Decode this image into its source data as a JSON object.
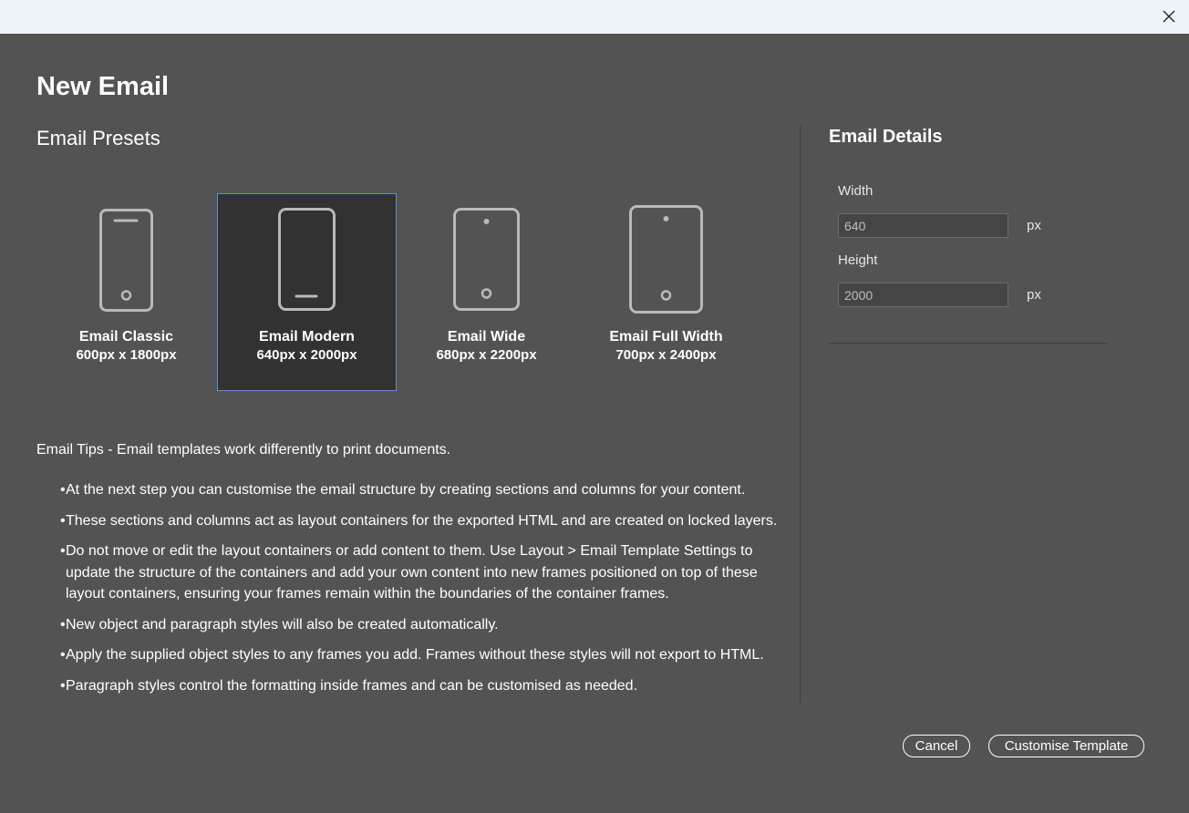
{
  "window": {
    "close_icon": "close-icon"
  },
  "dialog": {
    "title": "New Email"
  },
  "presets": {
    "heading": "Email Presets",
    "items": [
      {
        "name": "Email Classic",
        "size": "600px x 1800px",
        "selected": false,
        "icon": "phone-icon"
      },
      {
        "name": "Email Modern",
        "size": "640px x 2000px",
        "selected": true,
        "icon": "phone-modern-icon"
      },
      {
        "name": "Email Wide",
        "size": "680px x 2200px",
        "selected": false,
        "icon": "tablet-icon"
      },
      {
        "name": "Email Full Width",
        "size": "700px x 2400px",
        "selected": false,
        "icon": "tablet-large-icon"
      }
    ]
  },
  "details": {
    "heading": "Email Details",
    "width_label": "Width",
    "width_value": "640",
    "width_unit": "px",
    "height_label": "Height",
    "height_value": "2000",
    "height_unit": "px"
  },
  "tips": {
    "title": "Email Tips - Email templates work differently to print documents.",
    "bullet": "•",
    "items": [
      "At the next step you can customise the email structure by creating sections and columns for your content.",
      "These sections and columns act as layout containers for the exported HTML and are created on locked layers.",
      "Do not move or edit the layout containers or add content to them. Use Layout > Email Template Settings to update the structure of the containers and add your own content into new frames positioned on top of these layout containers, ensuring your frames remain within the boundaries of the container frames.",
      "New object and paragraph styles will also be created automatically.",
      "Apply the supplied object styles to any frames you add. Frames without these styles will not export to HTML.",
      "Paragraph styles control the formatting inside frames and can be customised as needed."
    ]
  },
  "buttons": {
    "cancel": "Cancel",
    "customise": "Customise Template"
  },
  "colors": {
    "dialog_bg": "#535353",
    "selected_bg": "#323232",
    "selected_border": "#5b8fd6",
    "titlebar_bg": "#eef3f8",
    "icon_stroke": "#b9b9b9"
  }
}
